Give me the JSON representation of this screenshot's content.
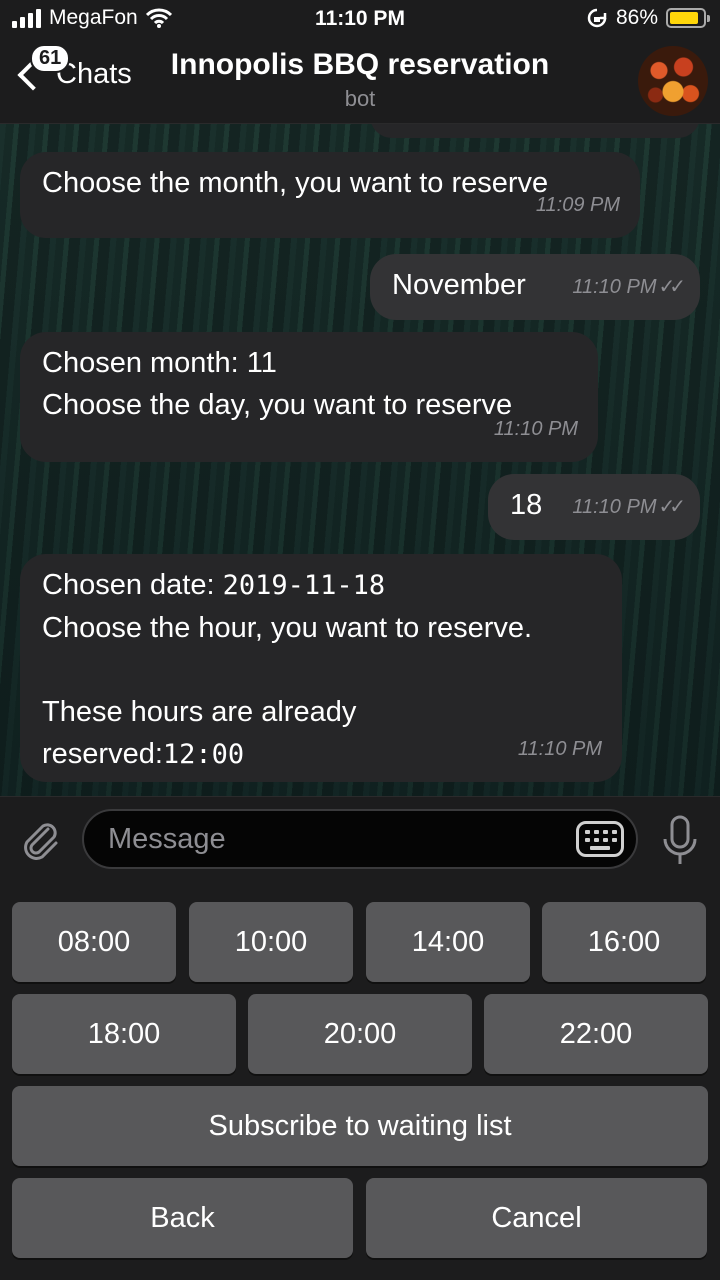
{
  "status_bar": {
    "carrier": "MegaFon",
    "time": "11:10 PM",
    "battery_percent": "86%",
    "battery_level": 0.86,
    "battery_color": "#ffd60a"
  },
  "navbar": {
    "back_label": "Chats",
    "unread_badge": "61",
    "title": "Innopolis BBQ reservation",
    "subtitle": "bot"
  },
  "messages": [
    {
      "direction": "in",
      "text": "Choose the month, you want to reserve",
      "time": "11:09 PM"
    },
    {
      "direction": "out",
      "text": "November",
      "time": "11:10 PM",
      "ticks": "✓✓"
    },
    {
      "direction": "in",
      "line1": "Chosen month: 11",
      "line2": "Choose the day, you want to reserve",
      "time": "11:10 PM"
    },
    {
      "direction": "out",
      "text": "18",
      "time": "11:10 PM",
      "ticks": "✓✓"
    },
    {
      "direction": "in",
      "line1_prefix": "Chosen date: ",
      "line1_code": "2019-11-18",
      "line2": "Choose the hour, you want to reserve.",
      "line3": "These hours are already",
      "line4_prefix": "reserved:",
      "line4_code": "12:00",
      "time": "11:10 PM"
    }
  ],
  "input": {
    "placeholder": "Message"
  },
  "keyboard": {
    "row1": [
      "08:00",
      "10:00",
      "14:00",
      "16:00"
    ],
    "row2": [
      "18:00",
      "20:00",
      "22:00"
    ],
    "subscribe": "Subscribe to waiting list",
    "back": "Back",
    "cancel": "Cancel"
  }
}
